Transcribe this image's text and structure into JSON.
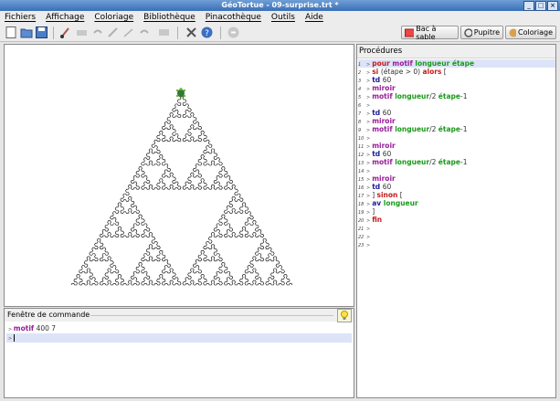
{
  "window": {
    "title": "GéoTortue - 09-surprise.trt *"
  },
  "menu": [
    "Fichiers",
    "Affichage",
    "Coloriage",
    "Bibliothèque",
    "Pinacothèque",
    "Outils",
    "Aide"
  ],
  "toolbar_right": {
    "sandbox": "Bac à sable",
    "desk": "Pupitre",
    "coloring": "Coloriage"
  },
  "command": {
    "title": "Fenêtre de commande",
    "line1": {
      "keyword": "motif",
      "args": "400 7"
    },
    "line2": ""
  },
  "procedures": {
    "title": "Procédures",
    "lines": [
      {
        "n": "1",
        "t": [
          [
            "kr",
            "pour "
          ],
          [
            "kp",
            "motif "
          ],
          [
            "kg",
            "longueur étape"
          ]
        ]
      },
      {
        "n": "2",
        "t": [
          [
            "kr",
            "si "
          ],
          [
            "num",
            " (étape > 0) "
          ],
          [
            "kr",
            "alors"
          ],
          [
            "num",
            " ["
          ]
        ]
      },
      {
        "n": "3",
        "t": [
          [
            "kb",
            "td "
          ],
          [
            "num",
            "60"
          ]
        ]
      },
      {
        "n": "4",
        "t": [
          [
            "kp",
            "miroir"
          ]
        ]
      },
      {
        "n": "5",
        "t": [
          [
            "kp",
            "motif "
          ],
          [
            "kg",
            "longueur"
          ],
          [
            "num",
            "/2 "
          ],
          [
            "kg",
            "étape"
          ],
          [
            "num",
            "-1"
          ]
        ]
      },
      {
        "n": "6",
        "t": []
      },
      {
        "n": "7",
        "t": [
          [
            "kb",
            "td "
          ],
          [
            "num",
            "60"
          ]
        ]
      },
      {
        "n": "8",
        "t": [
          [
            "kp",
            "miroir"
          ]
        ]
      },
      {
        "n": "9",
        "t": [
          [
            "kp",
            "motif "
          ],
          [
            "kg",
            "longueur"
          ],
          [
            "num",
            "/2 "
          ],
          [
            "kg",
            "étape"
          ],
          [
            "num",
            "-1"
          ]
        ]
      },
      {
        "n": "10",
        "t": []
      },
      {
        "n": "11",
        "t": [
          [
            "kp",
            "miroir"
          ]
        ]
      },
      {
        "n": "12",
        "t": [
          [
            "kb",
            "td "
          ],
          [
            "num",
            "60"
          ]
        ]
      },
      {
        "n": "13",
        "t": [
          [
            "kp",
            "motif "
          ],
          [
            "kg",
            "longueur"
          ],
          [
            "num",
            "/2 "
          ],
          [
            "kg",
            "étape"
          ],
          [
            "num",
            "-1"
          ]
        ]
      },
      {
        "n": "14",
        "t": []
      },
      {
        "n": "15",
        "t": [
          [
            "kp",
            "miroir"
          ]
        ]
      },
      {
        "n": "16",
        "t": [
          [
            "kb",
            "td "
          ],
          [
            "num",
            "60"
          ]
        ]
      },
      {
        "n": "17",
        "t": [
          [
            "num",
            "] "
          ],
          [
            "kr",
            "sinon"
          ],
          [
            "num",
            " ["
          ]
        ]
      },
      {
        "n": "18",
        "t": [
          [
            "kb",
            "av "
          ],
          [
            "kg",
            "longueur"
          ]
        ]
      },
      {
        "n": "19",
        "t": [
          [
            "num",
            "]"
          ]
        ]
      },
      {
        "n": "20",
        "t": [
          [
            "kr",
            "fin"
          ]
        ]
      },
      {
        "n": "21",
        "t": []
      },
      {
        "n": "22",
        "t": []
      },
      {
        "n": "23",
        "t": []
      }
    ]
  },
  "colors": {
    "title_bar": "#3a6fb7",
    "highlight": "#dde4f7",
    "keyword_proc": "#9a1a9a",
    "keyword_param": "#1a9a1a",
    "keyword_ctrl": "#c31a1a",
    "keyword_cmd": "#1a1a9a"
  },
  "drawing": {
    "procedure": "motif",
    "length": 400,
    "steps": 7
  }
}
